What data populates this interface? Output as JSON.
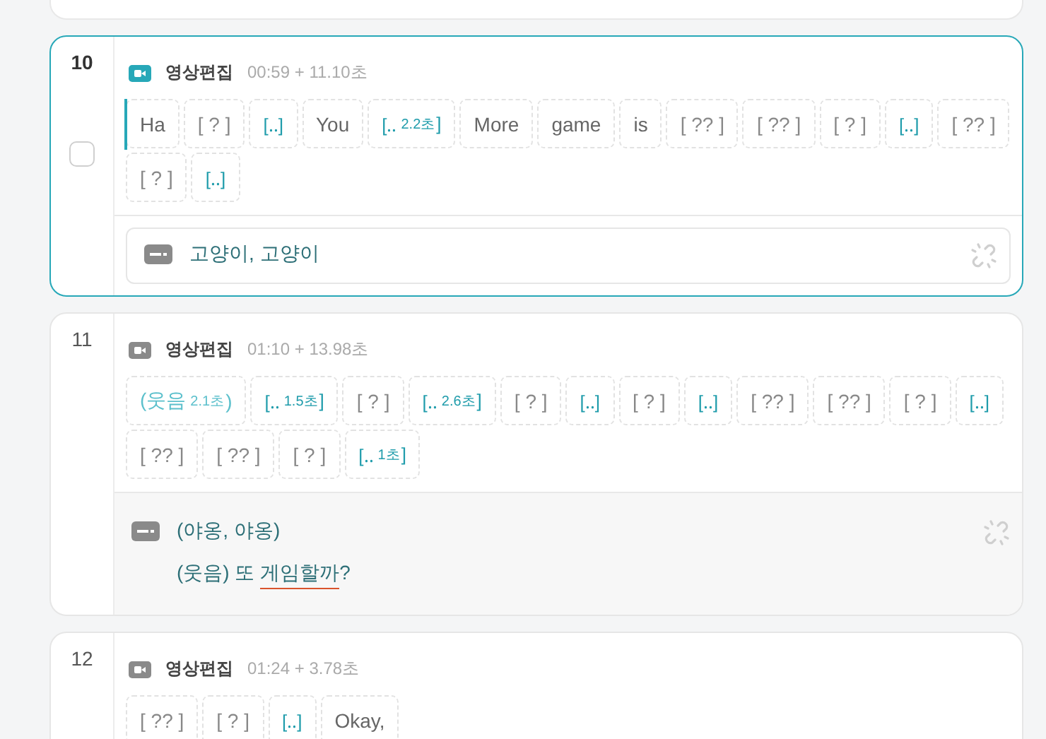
{
  "cards": [
    {
      "index": "10",
      "selected": true,
      "checkbox": {
        "checked": false
      },
      "source": "영상편집",
      "time": "00:59 + 11.10초",
      "tokens": [
        {
          "kind": "word",
          "label": "Ha"
        },
        {
          "kind": "unknown",
          "label": "[ ? ]"
        },
        {
          "kind": "pause",
          "label": "[‥]"
        },
        {
          "kind": "word",
          "label": "You"
        },
        {
          "kind": "pause",
          "label": "[‥",
          "duration": "2.2초",
          "end": "]"
        },
        {
          "kind": "word",
          "label": "More"
        },
        {
          "kind": "word",
          "label": "game"
        },
        {
          "kind": "word",
          "label": "is"
        },
        {
          "kind": "unknown",
          "label": "[ ?? ]"
        },
        {
          "kind": "unknown",
          "label": "[ ?? ]"
        },
        {
          "kind": "unknown",
          "label": "[ ? ]"
        },
        {
          "kind": "pause",
          "label": "[‥]"
        },
        {
          "kind": "unknown",
          "label": "[ ?? ]"
        },
        {
          "kind": "unknown",
          "label": "[ ? ]"
        },
        {
          "kind": "pause",
          "label": "[‥]"
        }
      ],
      "subtitle": {
        "editing": true,
        "lines": [
          [
            {
              "text": "고양이, 고양이",
              "misspelled": false
            }
          ]
        ]
      }
    },
    {
      "index": "11",
      "selected": false,
      "source": "영상편집",
      "time": "01:10 + 13.98초",
      "tokens": [
        {
          "kind": "sound",
          "label": "(웃음",
          "duration": "2.1초",
          "end": ")"
        },
        {
          "kind": "pause",
          "label": "[‥",
          "duration": "1.5초",
          "end": "]"
        },
        {
          "kind": "unknown",
          "label": "[ ? ]"
        },
        {
          "kind": "pause",
          "label": "[‥",
          "duration": "2.6초",
          "end": "]"
        },
        {
          "kind": "unknown",
          "label": "[ ? ]"
        },
        {
          "kind": "pause",
          "label": "[‥]"
        },
        {
          "kind": "unknown",
          "label": "[ ? ]"
        },
        {
          "kind": "pause",
          "label": "[‥]"
        },
        {
          "kind": "unknown",
          "label": "[ ?? ]"
        },
        {
          "kind": "unknown",
          "label": "[ ?? ]"
        },
        {
          "kind": "unknown",
          "label": "[ ? ]"
        },
        {
          "kind": "pause",
          "label": "[‥]"
        },
        {
          "kind": "unknown",
          "label": "[ ?? ]"
        },
        {
          "kind": "unknown",
          "label": "[ ?? ]"
        },
        {
          "kind": "unknown",
          "label": "[ ? ]"
        },
        {
          "kind": "pause",
          "label": "[‥",
          "duration": "1초",
          "end": "]"
        }
      ],
      "subtitle": {
        "editing": false,
        "lines": [
          [
            {
              "text": "(야옹, 야옹)",
              "misspelled": false
            }
          ],
          [
            {
              "text": "(웃음) 또 ",
              "misspelled": false
            },
            {
              "text": "게임할까",
              "misspelled": true
            },
            {
              "text": "?",
              "misspelled": false
            }
          ]
        ]
      }
    },
    {
      "index": "12",
      "selected": false,
      "source": "영상편집",
      "time": "01:24 + 3.78초",
      "tokens": [
        {
          "kind": "unknown",
          "label": "[ ?? ]"
        },
        {
          "kind": "unknown",
          "label": "[ ? ]"
        },
        {
          "kind": "pause",
          "label": "[‥]"
        },
        {
          "kind": "word",
          "label": "Okay,"
        }
      ]
    }
  ]
}
